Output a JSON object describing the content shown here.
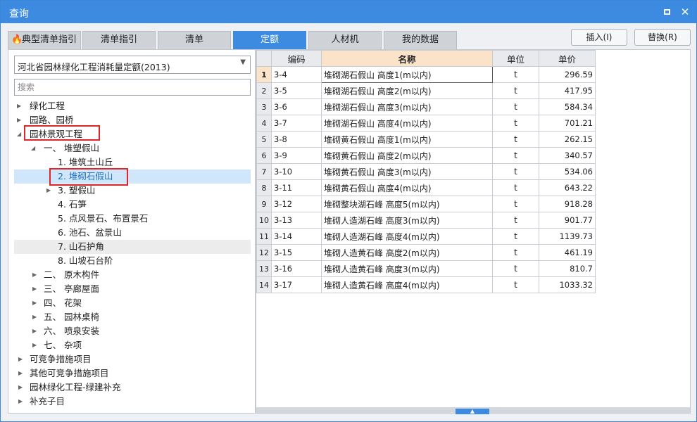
{
  "window": {
    "title": "查询"
  },
  "tabs": [
    {
      "label": "典型清单指引",
      "icon": "fire-icon"
    },
    {
      "label": "清单指引"
    },
    {
      "label": "清单"
    },
    {
      "label": "定额"
    },
    {
      "label": "人材机"
    },
    {
      "label": "我的数据"
    }
  ],
  "actions": {
    "insert": "插入(I)",
    "replace": "替换(R)"
  },
  "left": {
    "library": "河北省园林绿化工程消耗量定额(2013)",
    "search_placeholder": "搜索",
    "tree": [
      {
        "label": "绿化工程",
        "expander": "▶"
      },
      {
        "label": "园路、园桥",
        "expander": "▶"
      },
      {
        "label": "园林景观工程",
        "expander": "◢"
      },
      {
        "label": "一、 堆塑假山",
        "expander": "◢"
      },
      {
        "label": "1. 堆筑土山丘",
        "expander": ""
      },
      {
        "label": "2. 堆砌石假山",
        "expander": ""
      },
      {
        "label": "3. 塑假山",
        "expander": "▶"
      },
      {
        "label": "4. 石笋",
        "expander": ""
      },
      {
        "label": "5. 点风景石、布置景石",
        "expander": ""
      },
      {
        "label": "6. 池石、盆景山",
        "expander": ""
      },
      {
        "label": "7. 山石护角",
        "expander": ""
      },
      {
        "label": "8. 山坡石台阶",
        "expander": ""
      },
      {
        "label": "二、 原木构件",
        "expander": "▶"
      },
      {
        "label": "三、 亭廊屋面",
        "expander": "▶"
      },
      {
        "label": "四、 花架",
        "expander": "▶"
      },
      {
        "label": "五、 园林桌椅",
        "expander": "▶"
      },
      {
        "label": "六、 喷泉安装",
        "expander": "▶"
      },
      {
        "label": "七、 杂项",
        "expander": "▶"
      },
      {
        "label": "可竞争措施项目",
        "expander": "▶"
      },
      {
        "label": "其他可竞争措施项目",
        "expander": "▶"
      },
      {
        "label": "园林绿化工程-绿建补充",
        "expander": "▶"
      },
      {
        "label": "补充子目",
        "expander": "▶"
      }
    ]
  },
  "grid": {
    "columns": [
      "编码",
      "名称",
      "单位",
      "单价"
    ],
    "rows": [
      [
        "1",
        "3-4",
        "堆砌湖石假山 高度1(m以内)",
        "t",
        "296.59"
      ],
      [
        "2",
        "3-5",
        "堆砌湖石假山 高度2(m以内)",
        "t",
        "417.95"
      ],
      [
        "3",
        "3-6",
        "堆砌湖石假山 高度3(m以内)",
        "t",
        "584.34"
      ],
      [
        "4",
        "3-7",
        "堆砌湖石假山 高度4(m以内)",
        "t",
        "701.21"
      ],
      [
        "5",
        "3-8",
        "堆砌黄石假山 高度1(m以内)",
        "t",
        "262.15"
      ],
      [
        "6",
        "3-9",
        "堆砌黄石假山 高度2(m以内)",
        "t",
        "340.57"
      ],
      [
        "7",
        "3-10",
        "堆砌黄石假山 高度3(m以内)",
        "t",
        "534.06"
      ],
      [
        "8",
        "3-11",
        "堆砌黄石假山 高度4(m以内)",
        "t",
        "643.22"
      ],
      [
        "9",
        "3-12",
        "堆砌整块湖石峰 高度5(m以内)",
        "t",
        "918.28"
      ],
      [
        "10",
        "3-13",
        "堆砌人造湖石峰 高度3(m以内)",
        "t",
        "901.77"
      ],
      [
        "11",
        "3-14",
        "堆砌人造湖石峰 高度4(m以内)",
        "t",
        "1139.73"
      ],
      [
        "12",
        "3-15",
        "堆砌人造黄石峰 高度2(m以内)",
        "t",
        "461.19"
      ],
      [
        "13",
        "3-16",
        "堆砌人造黄石峰 高度3(m以内)",
        "t",
        "810.7"
      ],
      [
        "14",
        "3-17",
        "堆砌人造黄石峰 高度4(m以内)",
        "t",
        "1033.32"
      ]
    ]
  },
  "colors": {
    "accent": "#3c8be0",
    "selection": "#cfe6fb",
    "highlight_box": "#e0252a",
    "sorted_header": "#fbe3c9"
  }
}
